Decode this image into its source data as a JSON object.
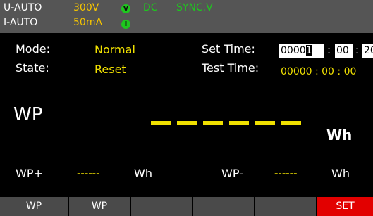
{
  "status": {
    "voltage_mode": "U-AUTO",
    "voltage_value": "300V",
    "v_indicator": "V",
    "coupling": "DC",
    "sync": "SYNC.V",
    "current_mode": "I-AUTO",
    "current_value": "50mA",
    "i_indicator": "I",
    "colors": {
      "bar": "#555555",
      "value": "#f5c400",
      "indicator": "#1ec71e"
    }
  },
  "info": {
    "mode_label": "Mode:",
    "mode_value": "Normal",
    "state_label": "State:",
    "state_value": "Reset",
    "set_time_label": "Set Time:",
    "set_time_hours_prefix": "0000",
    "set_time_hours_cursor": "1",
    "set_time_minutes": "00",
    "set_time_seconds": "20",
    "sep": ":",
    "test_time_label": "Test Time:",
    "test_time_value": "00000 : 00 : 00"
  },
  "measurement": {
    "title": "WP",
    "unit": "Wh",
    "display_value": "------",
    "wp_plus_label": "WP+",
    "wp_plus_value": "------",
    "wp_plus_unit": "Wh",
    "wp_minus_label": "WP-",
    "wp_minus_value": "------",
    "wp_minus_unit": "Wh",
    "color": "#f0e000"
  },
  "softkeys": [
    "WP",
    "WP",
    "",
    "",
    "",
    "SET"
  ],
  "active_softkey": "SET",
  "active_color": "#e20000"
}
